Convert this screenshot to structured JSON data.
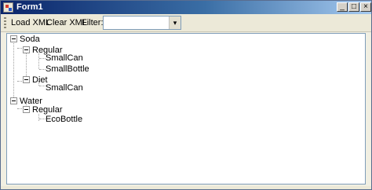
{
  "window": {
    "title": "Form1",
    "minimize_glyph": "_",
    "maximize_glyph": "□",
    "close_glyph": "×"
  },
  "toolbar": {
    "load_label": "Load XML",
    "clear_label": "Clear XML",
    "filter_label": "Filter:",
    "filter_value": "",
    "dropdown_glyph": "▾"
  },
  "tree": {
    "soda": "Soda",
    "soda_regular": "Regular",
    "small_can": "SmallCan",
    "small_bottle": "SmallBottle",
    "soda_diet": "Diet",
    "diet_small_can": "SmallCan",
    "water": "Water",
    "water_regular": "Regular",
    "eco_bottle": "EcoBottle"
  }
}
